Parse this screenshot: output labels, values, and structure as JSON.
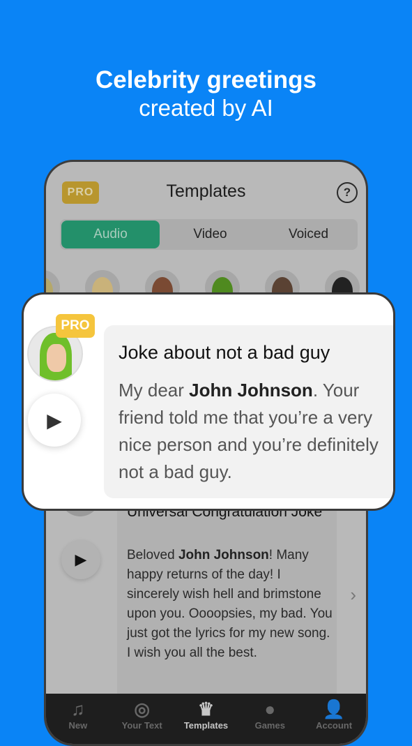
{
  "headline": {
    "line1": "Celebrity greetings",
    "line2": "created by AI"
  },
  "app": {
    "pro_badge": "PRO",
    "title": "Templates",
    "help_icon": "?",
    "segments": [
      "Audio",
      "Video",
      "Voiced"
    ],
    "active_segment": "Audio",
    "card": {
      "title": "Universal Congratulation Joke",
      "body_pre": "Beloved ",
      "body_bold": "John Johnson",
      "body_post": "! Many happy returns of the day! I sincerely wish hell and brimstone upon you. Oooopsies, my bad. You just got the lyrics for my new song. I wish you all the best."
    },
    "tabs": [
      {
        "label": "New",
        "icon": "music-note-icon"
      },
      {
        "label": "Your Text",
        "icon": "waveform-icon"
      },
      {
        "label": "Templates",
        "icon": "jester-hat-icon"
      },
      {
        "label": "Games",
        "icon": "fortune-ball-icon"
      },
      {
        "label": "Account",
        "icon": "person-icon"
      }
    ],
    "active_tab": "Templates"
  },
  "popup": {
    "pro_badge": "PRO",
    "title": "Joke about not a bad guy",
    "body_pre": "My dear ",
    "body_bold": "John Johnson",
    "body_post": ". Your friend told me that you’re a very nice person and you’re definitely not a bad guy."
  },
  "colors": {
    "background": "#0a84f6",
    "accent_green": "#23906a",
    "pro_yellow": "#f5c53d"
  }
}
